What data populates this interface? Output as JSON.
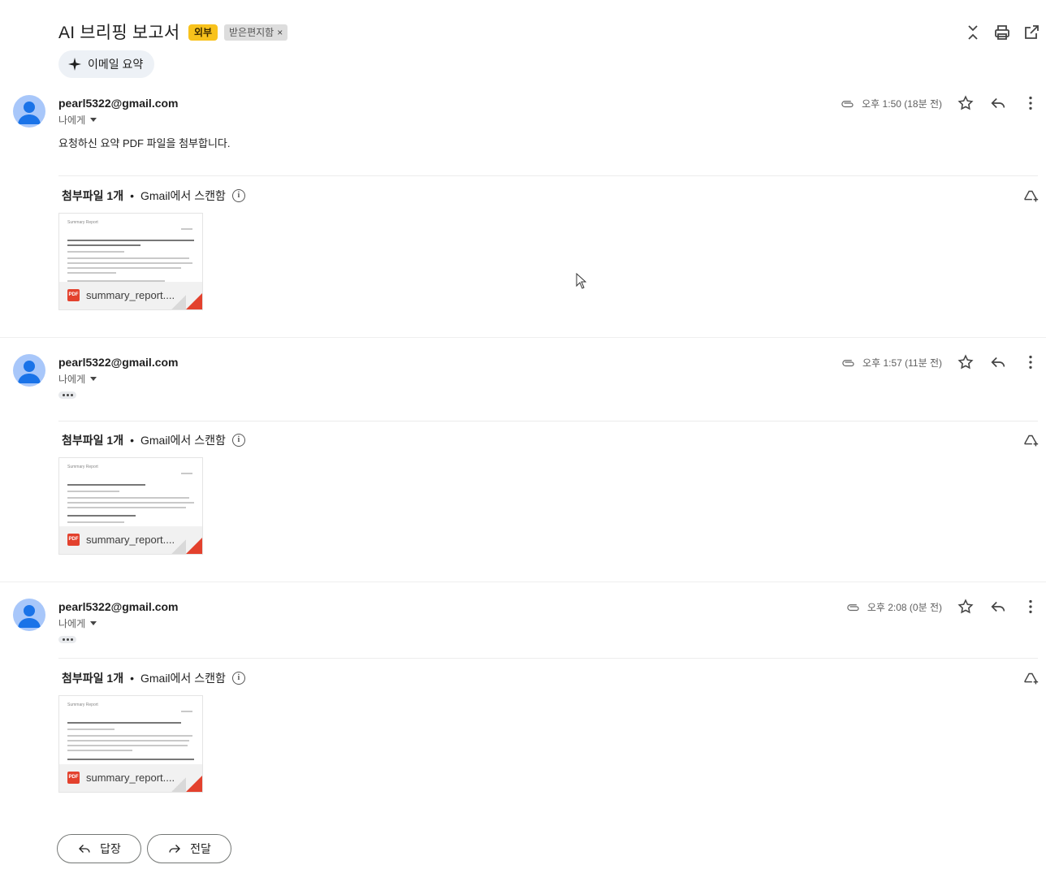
{
  "thread": {
    "subject": "AI 브리핑 보고서",
    "labels": {
      "external": "외부",
      "inbox": "받은편지함",
      "inbox_remove": "×"
    },
    "summary_button": "이메일 요약"
  },
  "messages": [
    {
      "sender": "pearl5322@gmail.com",
      "recipient": "나에게",
      "body": "요청하신 요약 PDF 파일을 첨부합니다.",
      "time": "오후 1:50 (18분 전)",
      "attachment_summary": {
        "count": "첨부파일 1개",
        "bullet": "•",
        "scan": "Gmail에서 스캔함",
        "info": "i"
      },
      "attachment": {
        "file_name": "summary_report....",
        "badge": "PDF",
        "preview_title": "Summary Report"
      }
    },
    {
      "sender": "pearl5322@gmail.com",
      "recipient": "나에게",
      "body": "",
      "time": "오후 1:57 (11분 전)",
      "attachment_summary": {
        "count": "첨부파일 1개",
        "bullet": "•",
        "scan": "Gmail에서 스캔함",
        "info": "i"
      },
      "attachment": {
        "file_name": "summary_report....",
        "badge": "PDF",
        "preview_title": "Summary Report"
      }
    },
    {
      "sender": "pearl5322@gmail.com",
      "recipient": "나에게",
      "body": "",
      "time": "오후 2:08 (0분 전)",
      "attachment_summary": {
        "count": "첨부파일 1개",
        "bullet": "•",
        "scan": "Gmail에서 스캔함",
        "info": "i"
      },
      "attachment": {
        "file_name": "summary_report....",
        "badge": "PDF",
        "preview_title": "Summary Report"
      }
    }
  ],
  "footer": {
    "reply_label": "답장",
    "forward_label": "전달"
  },
  "icons": {
    "collapse": "collapse-all-icon",
    "print": "print-icon",
    "open_new": "open-in-new-window-icon",
    "spark": "sparkle-icon",
    "attach": "paperclip-icon",
    "star": "star-icon",
    "reply": "reply-icon",
    "more": "more-vert-icon",
    "drive": "add-to-drive-icon",
    "forward": "forward-icon"
  },
  "colors": {
    "external_label": "#f8c21c",
    "avatar_bg": "#a8c7fa",
    "avatar_fg": "#1a73e8",
    "pdf_red": "#e3412d",
    "summary_bg": "#edf1f6"
  }
}
